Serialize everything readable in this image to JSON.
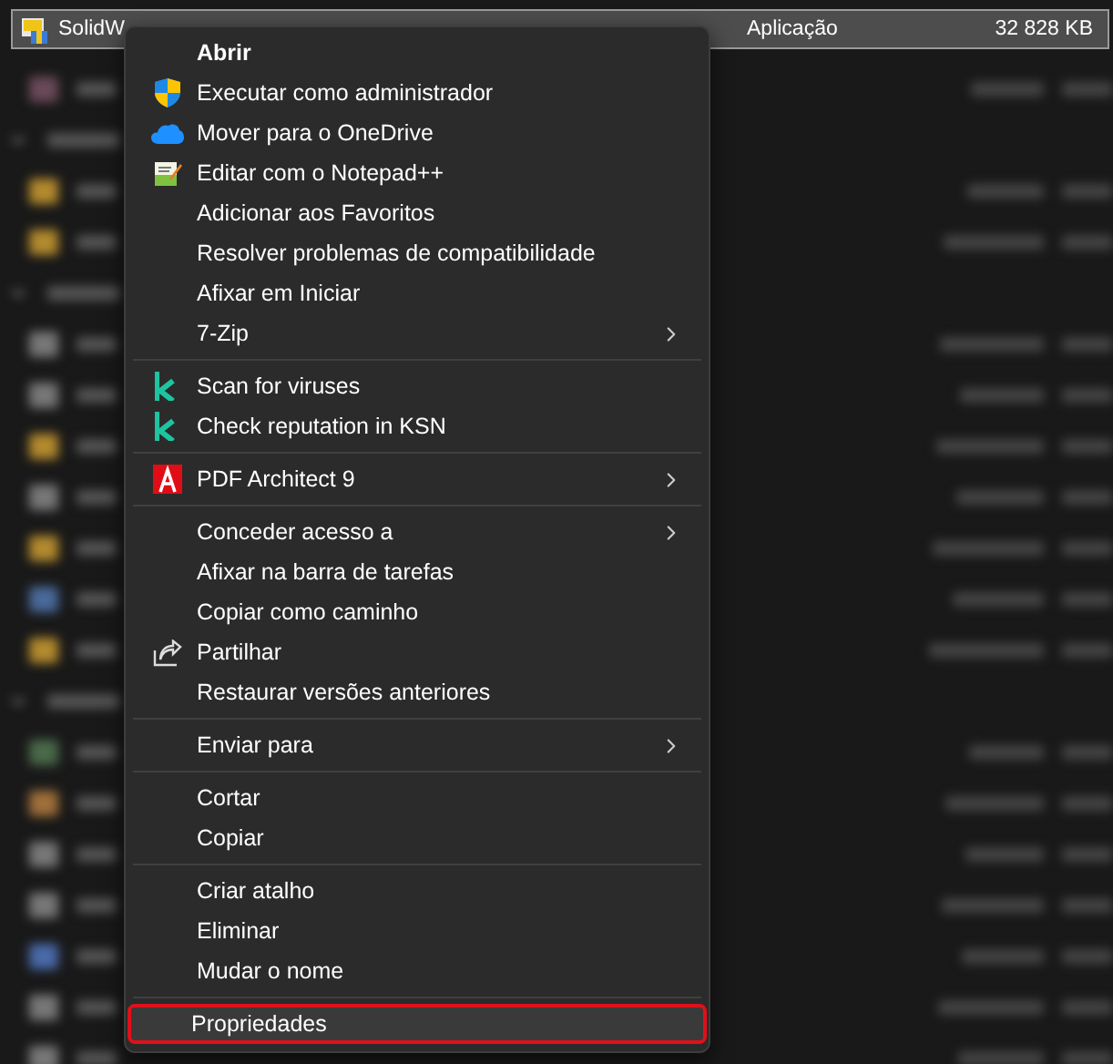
{
  "file_row": {
    "name": "SolidW",
    "type": "Aplicação",
    "size": "32 828 KB",
    "selected": true
  },
  "context_menu": {
    "sections": [
      {
        "items": [
          {
            "label": "Abrir",
            "kind": "none",
            "submenu": false,
            "default": true,
            "hovered": false,
            "circled": false
          },
          {
            "label": "Executar como administrador",
            "kind": "shield",
            "submenu": false,
            "default": false,
            "hovered": false,
            "circled": false
          },
          {
            "label": "Mover para o OneDrive",
            "kind": "cloud",
            "submenu": false,
            "default": false,
            "hovered": false,
            "circled": false
          },
          {
            "label": "Editar com o Notepad++",
            "kind": "notepad",
            "submenu": false,
            "default": false,
            "hovered": false,
            "circled": false
          },
          {
            "label": "Adicionar aos Favoritos",
            "kind": "none",
            "submenu": false,
            "default": false,
            "hovered": false,
            "circled": false
          },
          {
            "label": "Resolver problemas de compatibilidade",
            "kind": "none",
            "submenu": false,
            "default": false,
            "hovered": false,
            "circled": false
          },
          {
            "label": "Afixar em Iniciar",
            "kind": "none",
            "submenu": false,
            "default": false,
            "hovered": false,
            "circled": false
          },
          {
            "label": "7-Zip",
            "kind": "none",
            "submenu": true,
            "default": false,
            "hovered": false,
            "circled": false
          }
        ]
      },
      {
        "items": [
          {
            "label": "Scan for viruses",
            "kind": "k",
            "submenu": false,
            "default": false,
            "hovered": false,
            "circled": false
          },
          {
            "label": "Check reputation in KSN",
            "kind": "k",
            "submenu": false,
            "default": false,
            "hovered": false,
            "circled": false
          }
        ]
      },
      {
        "items": [
          {
            "label": "PDF Architect 9",
            "kind": "pdf",
            "submenu": true,
            "default": false,
            "hovered": false,
            "circled": false
          }
        ]
      },
      {
        "items": [
          {
            "label": "Conceder acesso a",
            "kind": "none",
            "submenu": true,
            "default": false,
            "hovered": false,
            "circled": false
          },
          {
            "label": "Afixar na barra de tarefas",
            "kind": "none",
            "submenu": false,
            "default": false,
            "hovered": false,
            "circled": false
          },
          {
            "label": "Copiar como caminho",
            "kind": "none",
            "submenu": false,
            "default": false,
            "hovered": false,
            "circled": false
          },
          {
            "label": "Partilhar",
            "kind": "share",
            "submenu": false,
            "default": false,
            "hovered": false,
            "circled": false
          },
          {
            "label": "Restaurar versões anteriores",
            "kind": "none",
            "submenu": false,
            "default": false,
            "hovered": false,
            "circled": false
          }
        ]
      },
      {
        "items": [
          {
            "label": "Enviar para",
            "kind": "none",
            "submenu": true,
            "default": false,
            "hovered": false,
            "circled": false
          }
        ]
      },
      {
        "items": [
          {
            "label": "Cortar",
            "kind": "none",
            "submenu": false,
            "default": false,
            "hovered": false,
            "circled": false
          },
          {
            "label": "Copiar",
            "kind": "none",
            "submenu": false,
            "default": false,
            "hovered": false,
            "circled": false
          }
        ]
      },
      {
        "items": [
          {
            "label": "Criar atalho",
            "kind": "none",
            "submenu": false,
            "default": false,
            "hovered": false,
            "circled": false
          },
          {
            "label": "Eliminar",
            "kind": "none",
            "submenu": false,
            "default": false,
            "hovered": false,
            "circled": false
          },
          {
            "label": "Mudar o nome",
            "kind": "none",
            "submenu": false,
            "default": false,
            "hovered": false,
            "circled": false
          }
        ]
      },
      {
        "items": [
          {
            "label": "Propriedades",
            "kind": "none",
            "submenu": false,
            "default": false,
            "hovered": true,
            "circled": true
          }
        ]
      }
    ]
  }
}
